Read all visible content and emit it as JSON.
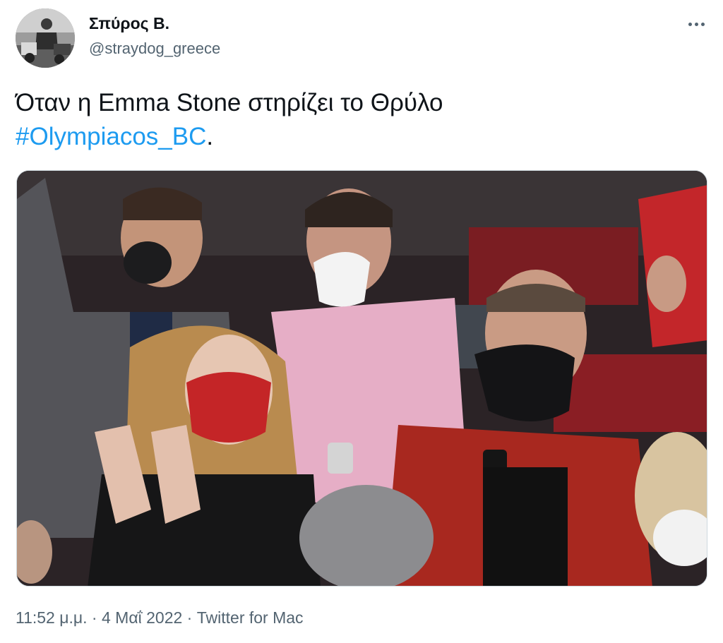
{
  "author": {
    "display_name": "Σπύρος Β.",
    "handle": "@straydog_greece"
  },
  "tweet": {
    "text_main": "Όταν η Emma Stone στηρίζει το Θρύλο",
    "hashtag": "#Olympiacos_BC",
    "text_end": "."
  },
  "meta": {
    "time": "11:52 μ.μ.",
    "separator_1": " · ",
    "date": "4 Μαΐ 2022",
    "separator_2": " · ",
    "source": "Twitter for Mac"
  },
  "colors": {
    "link": "#1d9bf0",
    "secondary_text": "#536471",
    "primary_text": "#0f1419"
  },
  "icons": {
    "more": "more-horizontal-icon"
  }
}
